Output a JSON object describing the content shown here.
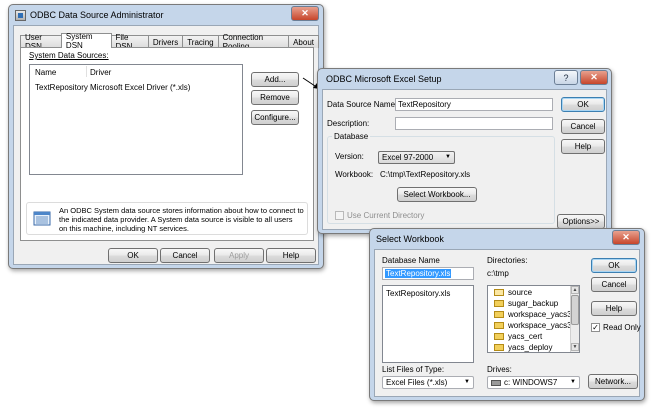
{
  "odbc_admin": {
    "title": "ODBC Data Source Administrator",
    "tabs": [
      "User DSN",
      "System DSN",
      "File DSN",
      "Drivers",
      "Tracing",
      "Connection Pooling",
      "About"
    ],
    "section_label": "System Data Sources:",
    "columns": [
      "Name",
      "Driver"
    ],
    "rows": [
      {
        "name": "TextRepository",
        "driver": "Microsoft Excel Driver (*.xls)"
      }
    ],
    "side_buttons": [
      "Add...",
      "Remove",
      "Configure..."
    ],
    "info_text_lines": [
      "An ODBC System data source stores information about how to connect to",
      "the indicated data provider.   A System data source is visible to all users",
      "on this machine, including NT services."
    ],
    "footer_buttons": [
      "OK",
      "Cancel",
      "Apply",
      "Help"
    ],
    "close_label": "✕"
  },
  "excel_setup": {
    "title": "ODBC Microsoft Excel Setup",
    "help_glyph": "?",
    "close_label": "✕",
    "dsn_label": "Data Source Name:",
    "dsn_value": "TextRepository",
    "desc_label": "Description:",
    "desc_value": "",
    "database_label": "Database",
    "version_label": "Version:",
    "version_value": "Excel 97-2000",
    "workbook_label": "Workbook:",
    "workbook_value": "C:\\tmp\\TextRepository.xls",
    "select_workbook": "Select Workbook...",
    "use_current_dir": "Use Current Directory",
    "buttons": [
      "OK",
      "Cancel",
      "Help"
    ],
    "options": "Options>>"
  },
  "select_workbook": {
    "title": "Select Workbook",
    "close_label": "✕",
    "db_name_label": "Database Name",
    "db_name_value": "TextRepository.xls",
    "files": [
      "TextRepository.xls"
    ],
    "directories_label": "Directories:",
    "current_dir": "c:\\tmp",
    "folders": [
      "source",
      "sugar_backup",
      "workspace_yacs3",
      "workspace_yacs3",
      "yacs_cert",
      "yacs_deploy"
    ],
    "file_type_label": "List Files of Type:",
    "file_type_value": "Excel Files (*.xls)",
    "drives_label": "Drives:",
    "drive_value": "c: WINDOWS7",
    "buttons": [
      "OK",
      "Cancel",
      "Help"
    ],
    "read_only": "Read Only",
    "network": "Network..."
  }
}
